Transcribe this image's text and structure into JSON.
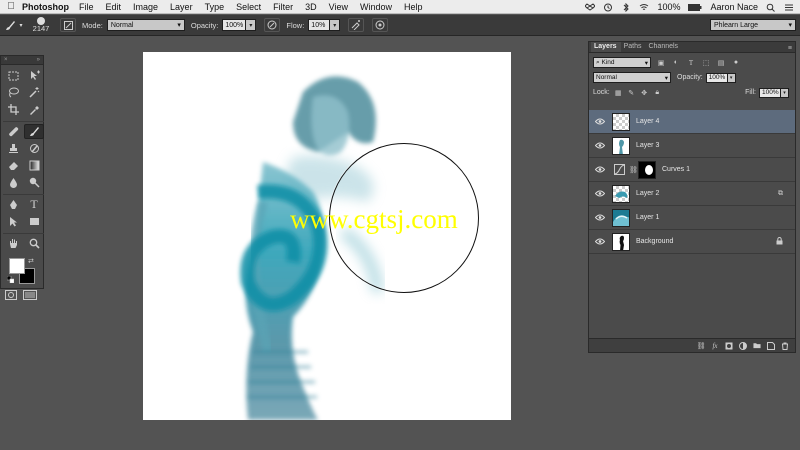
{
  "menubar": {
    "app": "Photoshop",
    "items": [
      "File",
      "Edit",
      "Image",
      "Layer",
      "Type",
      "Select",
      "Filter",
      "3D",
      "View",
      "Window",
      "Help"
    ],
    "battery": "100%",
    "user": "Aaron Nace"
  },
  "options": {
    "brush_size": "2147",
    "mode_label": "Mode:",
    "mode_value": "Normal",
    "opacity_label": "Opacity:",
    "opacity_value": "100%",
    "flow_label": "Flow:",
    "flow_value": "10%",
    "workspace": "Phlearn Large"
  },
  "layers_panel": {
    "tabs": [
      "Layers",
      "Paths",
      "Channels"
    ],
    "kind": "Kind",
    "blend_mode": "Normal",
    "opacity_label": "Opacity:",
    "opacity_value": "100%",
    "lock_label": "Lock:",
    "fill_label": "Fill:",
    "fill_value": "100%",
    "layers": [
      {
        "name": "Layer 4",
        "selected": true
      },
      {
        "name": "Layer 3",
        "selected": false
      },
      {
        "name": "Curves 1",
        "selected": false
      },
      {
        "name": "Layer 2",
        "selected": false
      },
      {
        "name": "Layer 1",
        "selected": false
      },
      {
        "name": "Background",
        "selected": false
      }
    ]
  },
  "canvas": {
    "watermark": "www.cgtsj.com"
  },
  "colors": {
    "accent_selected": "#5d6b7d",
    "watermark": "#ffff00",
    "teal": "#2fa4b8"
  }
}
